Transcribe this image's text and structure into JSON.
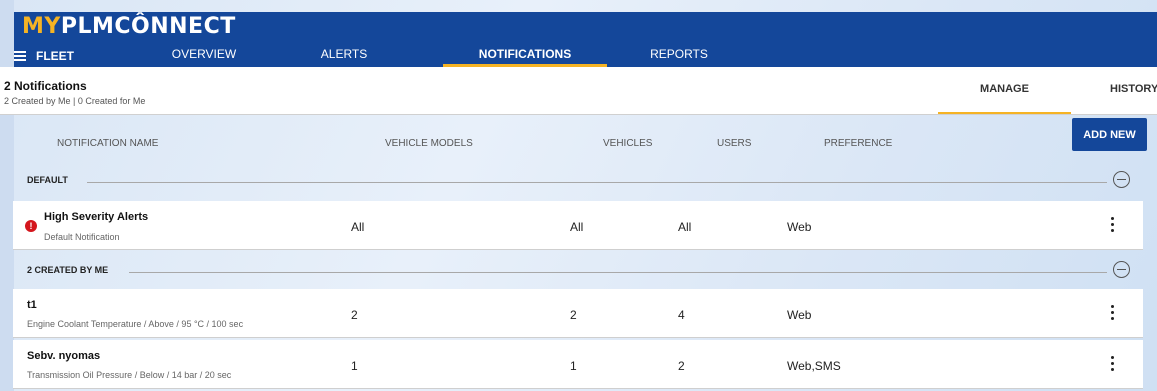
{
  "app": {
    "logo_prefix": "MY",
    "logo_rest": "PLMCÔNNECT"
  },
  "nav": {
    "fleet_label": "FLEET",
    "tabs": [
      {
        "label": "OVERVIEW",
        "active": false
      },
      {
        "label": "ALERTS",
        "active": false
      },
      {
        "label": "NOTIFICATIONS",
        "active": true
      },
      {
        "label": "REPORTS",
        "active": false
      }
    ]
  },
  "subheader": {
    "title": "2 Notifications",
    "subtitle": "2 Created by Me | 0 Created for Me",
    "tabs": [
      {
        "label": "MANAGE",
        "active": true
      },
      {
        "label": "HISTORY",
        "active": false
      }
    ]
  },
  "table": {
    "columns": [
      "NOTIFICATION NAME",
      "VEHICLE MODELS",
      "VEHICLES",
      "USERS",
      "PREFERENCE"
    ],
    "add_new_label": "ADD NEW",
    "sections": [
      {
        "label": "DEFAULT",
        "rows": [
          {
            "name": "High Severity Alerts",
            "desc": "Default Notification",
            "vehicle_models": "All",
            "vehicles": "All",
            "users": "All",
            "preference": "Web",
            "severity_icon": "exclamation-icon"
          }
        ]
      },
      {
        "label": "2 CREATED BY ME",
        "rows": [
          {
            "name": "t1",
            "desc": "Engine Coolant Temperature /  Above  / 95 °C  / 100 sec",
            "vehicle_models": "2",
            "vehicles": "2",
            "users": "4",
            "preference": "Web"
          },
          {
            "name": "Sebv. nyomas",
            "desc": "Transmission Oil Pressure /  Below  / 14 bar  / 20 sec",
            "vehicle_models": "1",
            "vehicles": "1",
            "users": "2",
            "preference": "Web,SMS"
          }
        ]
      }
    ]
  },
  "colors": {
    "header_bg": "#14479a",
    "accent": "#f5b324",
    "alert": "#d4161d"
  }
}
